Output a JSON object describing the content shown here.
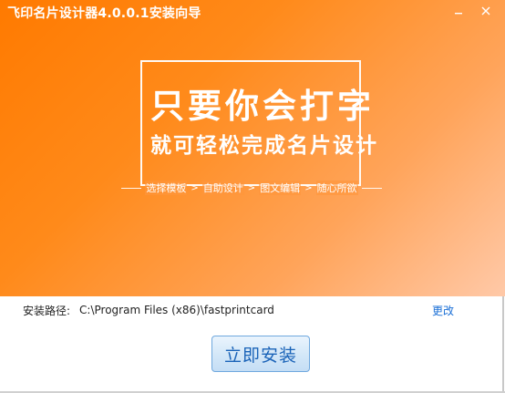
{
  "window": {
    "title": "飞印名片设计器4.0.0.1安装向导"
  },
  "controls": {
    "minimize_icon": "minimize-icon",
    "close_icon": "close-icon"
  },
  "banner": {
    "slogan_line1": "只要你会打字",
    "slogan_line2": "就可轻松完成名片设计",
    "steps": [
      "选择模板",
      "自助设计",
      "图文编辑",
      "随心所欲"
    ],
    "step_separator": ">"
  },
  "install": {
    "path_label": "安装路径:",
    "path_value": "C:\\Program Files (x86)\\fastprintcard",
    "change_label": "更改",
    "install_button_label": "立即安装"
  },
  "colors": {
    "banner_start": "#ff7a00",
    "banner_end": "#ffc9a8",
    "link": "#1a6fd6",
    "button_text": "#1a63b8"
  }
}
